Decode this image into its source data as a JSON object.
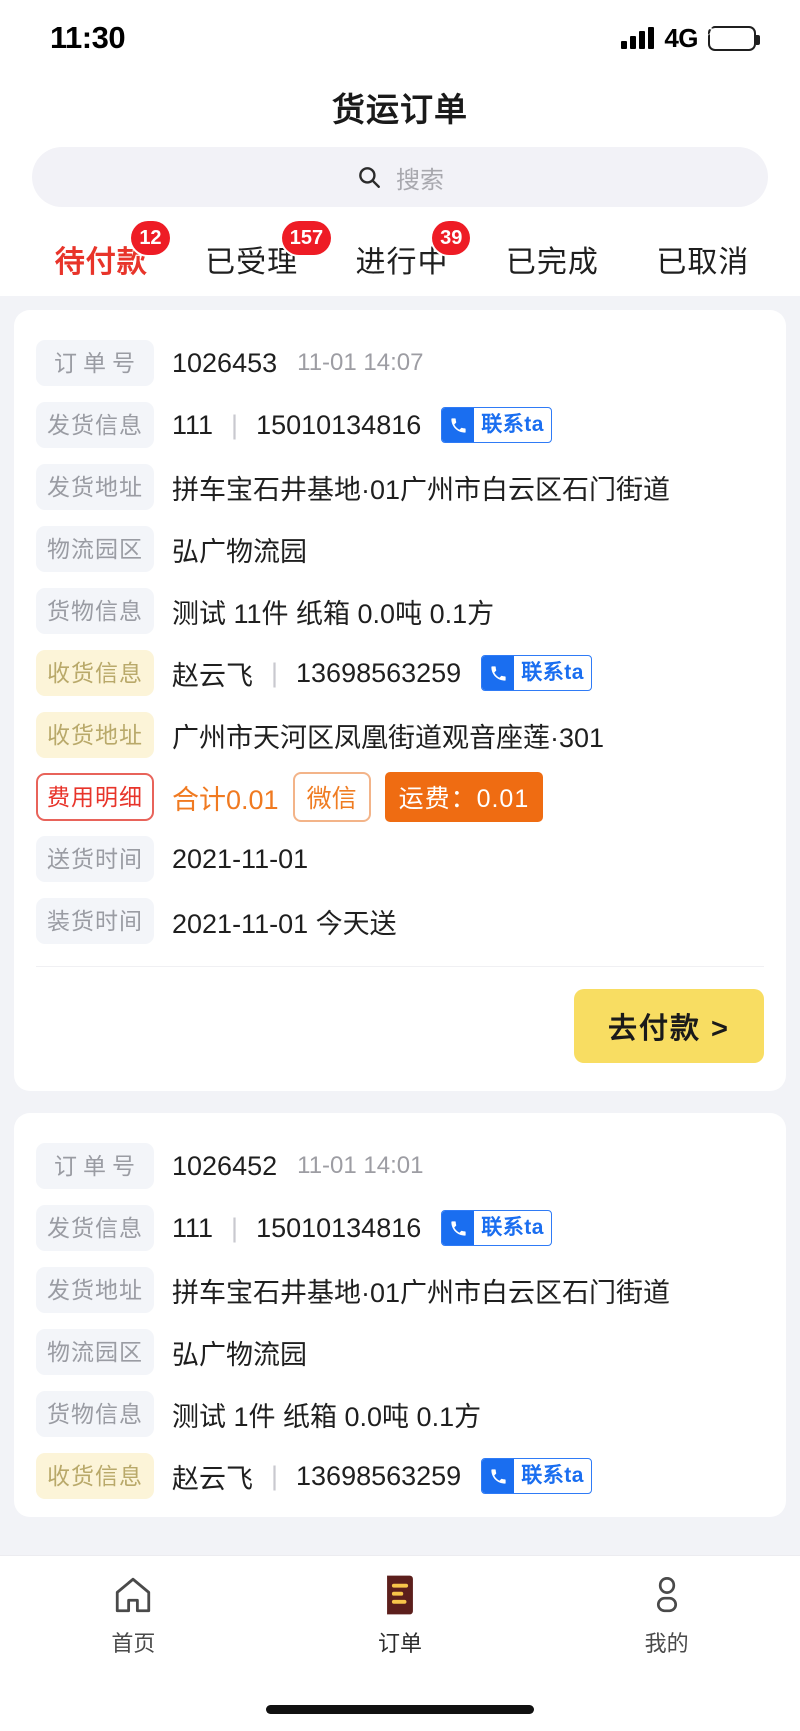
{
  "status_bar": {
    "time": "11:30",
    "network": "4G",
    "signal_icon": "signal-bars-icon",
    "battery_icon": "battery-charging-icon"
  },
  "header": {
    "title": "货运订单"
  },
  "search": {
    "placeholder": "搜索",
    "value": "",
    "icon": "search-icon"
  },
  "tabs": [
    {
      "label": "待付款",
      "badge": "12",
      "active": true
    },
    {
      "label": "已受理",
      "badge": "157",
      "active": false
    },
    {
      "label": "进行中",
      "badge": "39",
      "active": false
    },
    {
      "label": "已完成",
      "badge": "",
      "active": false
    },
    {
      "label": "已取消",
      "badge": "",
      "active": false
    }
  ],
  "labels": {
    "order_no": "订单号",
    "sender_info": "发货信息",
    "sender_address": "发货地址",
    "logistics_park": "物流园区",
    "goods_info": "货物信息",
    "receiver_info": "收货信息",
    "receiver_address": "收货地址",
    "fee_detail": "费用明细",
    "delivery_time": "送货时间",
    "loading_time": "装货时间",
    "contact": "联系ta",
    "pay_button": "去付款 >"
  },
  "orders": [
    {
      "order_no": "1026453",
      "order_time": "11-01 14:07",
      "sender_name": "111",
      "sender_phone": "15010134816",
      "sender_address": "拼车宝石井基地·01广州市白云区石门街道",
      "logistics_park": "弘广物流园",
      "goods_info": "测试 11件 纸箱 0.0吨 0.1方",
      "receiver_name": "赵云飞",
      "receiver_phone": "13698563259",
      "receiver_address": "广州市天河区凤凰街道观音座莲·301",
      "fee_total": "合计0.01",
      "pay_method": "微信",
      "freight": "运费：0.01",
      "delivery_time": "2021-11-01",
      "loading_time": "2021-11-01 今天送"
    },
    {
      "order_no": "1026452",
      "order_time": "11-01 14:01",
      "sender_name": "111",
      "sender_phone": "15010134816",
      "sender_address": "拼车宝石井基地·01广州市白云区石门街道",
      "logistics_park": "弘广物流园",
      "goods_info": "测试 1件 纸箱 0.0吨 0.1方",
      "receiver_name": "赵云飞",
      "receiver_phone": "13698563259"
    }
  ],
  "bottom_nav": [
    {
      "label": "首页",
      "icon": "home-icon",
      "active": false
    },
    {
      "label": "订单",
      "icon": "orders-icon",
      "active": true
    },
    {
      "label": "我的",
      "icon": "person-icon",
      "active": false
    }
  ],
  "colors": {
    "accent_red": "#e8342a",
    "badge_red": "#ee1c25",
    "orange": "#ef6c12",
    "pay_yellow": "#f8dd62",
    "contact_blue": "#1a6ef0",
    "page_bg": "#f2f3f7"
  }
}
